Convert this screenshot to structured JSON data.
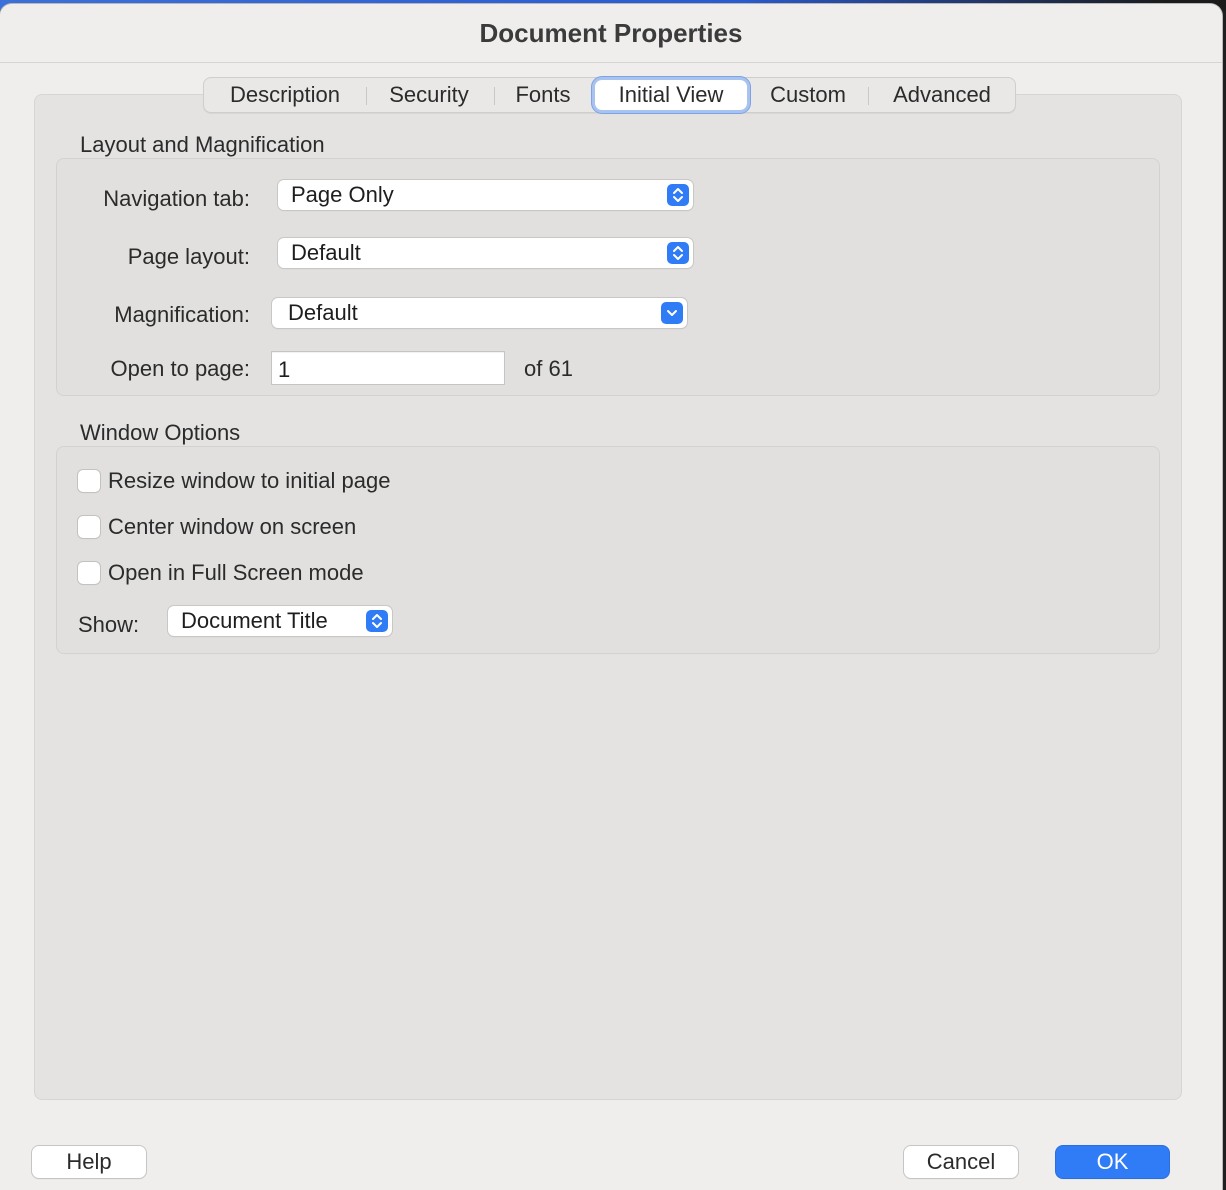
{
  "window": {
    "title": "Document Properties"
  },
  "tabs": [
    {
      "label": "Description",
      "active": false
    },
    {
      "label": "Security",
      "active": false
    },
    {
      "label": "Fonts",
      "active": false
    },
    {
      "label": "Initial View",
      "active": true
    },
    {
      "label": "Custom",
      "active": false
    },
    {
      "label": "Advanced",
      "active": false
    }
  ],
  "layout_section": {
    "title": "Layout and Magnification",
    "navigation_tab": {
      "label": "Navigation tab:",
      "value": "Page Only"
    },
    "page_layout": {
      "label": "Page layout:",
      "value": "Default"
    },
    "magnification": {
      "label": "Magnification:",
      "value": "Default"
    },
    "open_to_page": {
      "label": "Open to page:",
      "value": "1",
      "of_text": "of 61"
    }
  },
  "window_options": {
    "title": "Window Options",
    "checkboxes": [
      {
        "label": "Resize window to initial page",
        "checked": false
      },
      {
        "label": "Center window on screen",
        "checked": false
      },
      {
        "label": "Open in Full Screen mode",
        "checked": false
      }
    ],
    "show": {
      "label": "Show:",
      "value": "Document Title"
    }
  },
  "footer": {
    "help_label": "Help",
    "cancel_label": "Cancel",
    "ok_label": "OK"
  },
  "colors": {
    "accent": "#2f7cf6",
    "window_bg": "#efeeed",
    "panel_bg": "#e4e3e2"
  }
}
